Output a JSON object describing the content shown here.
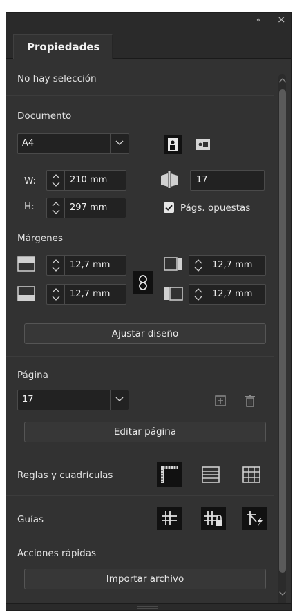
{
  "panel": {
    "tab_label": "Propiedades",
    "collapse_glyph": "«",
    "close_glyph": "×"
  },
  "selection": {
    "status": "No hay selección"
  },
  "document": {
    "heading": "Documento",
    "page_size": "A4",
    "width_label": "W:",
    "width_value": "210 mm",
    "height_label": "H:",
    "height_value": "297 mm",
    "pages_value": "17",
    "facing_pages_label": "Págs. opuestas",
    "facing_pages_checked": true
  },
  "margins": {
    "heading": "Márgenes",
    "top": "12,7 mm",
    "bottom": "12,7 mm",
    "inside": "12,7 mm",
    "outside": "12,7 mm",
    "adjust_button": "Ajustar diseño"
  },
  "page": {
    "heading": "Página",
    "current": "17",
    "edit_button": "Editar página"
  },
  "rulers": {
    "heading": "Reglas y cuadrículas"
  },
  "guides": {
    "heading": "Guías"
  },
  "quick_actions": {
    "heading": "Acciones rápidas",
    "import_button": "Importar archivo"
  },
  "colors": {
    "panel_bg": "#323232",
    "field_bg": "#222222",
    "checkbox": "#e6e6e6",
    "active_icon_bg": "#111111"
  },
  "icons": [
    "collapse-icon",
    "close-icon",
    "portrait-icon",
    "landscape-icon",
    "pages-icon",
    "checkbox-icon",
    "margin-top-icon",
    "margin-bottom-icon",
    "margin-inside-icon",
    "margin-outside-icon",
    "link-icon",
    "add-page-icon",
    "delete-page-icon",
    "rulers-icon",
    "baseline-grid-icon",
    "document-grid-icon",
    "guides-icon",
    "lock-guides-icon",
    "smart-guides-icon",
    "chevron-down-icon",
    "spinner-arrows-icon"
  ]
}
